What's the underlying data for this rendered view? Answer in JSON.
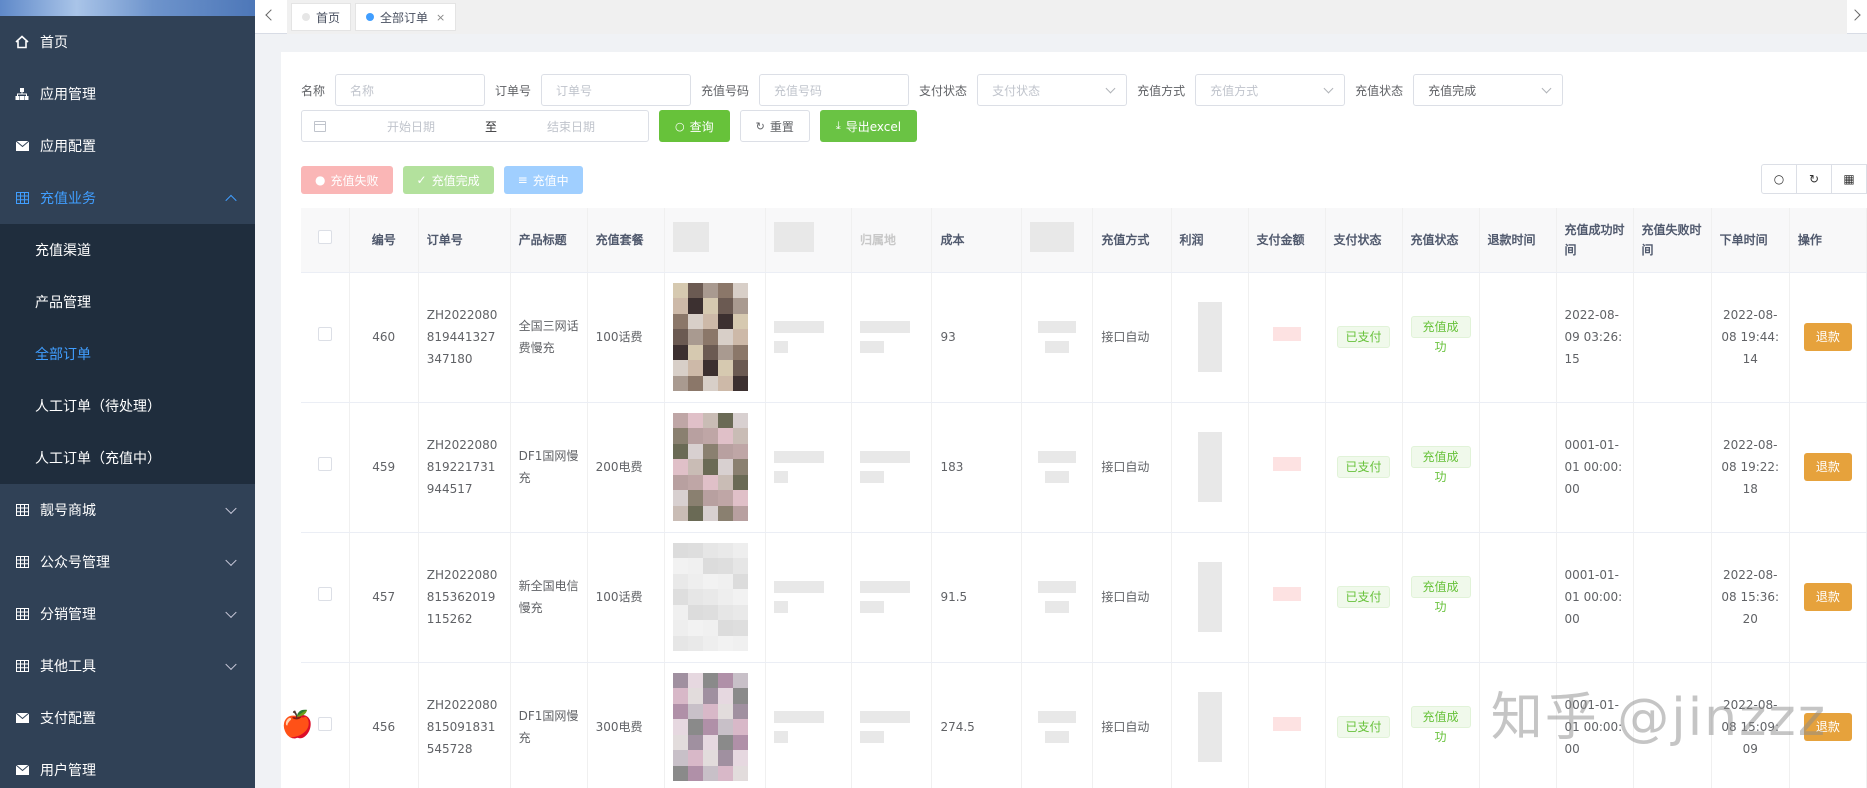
{
  "sidebar": {
    "items": [
      {
        "label": "首页",
        "icon": "home-icon"
      },
      {
        "label": "应用管理",
        "icon": "sitemap-icon"
      },
      {
        "label": "应用配置",
        "icon": "mail-icon"
      },
      {
        "label": "充值业务",
        "icon": "table-icon"
      },
      {
        "label": "靓号商城",
        "icon": "table-icon"
      },
      {
        "label": "公众号管理",
        "icon": "table-icon"
      },
      {
        "label": "分销管理",
        "icon": "table-icon"
      },
      {
        "label": "其他工具",
        "icon": "table-icon"
      },
      {
        "label": "支付配置",
        "icon": "mail-icon"
      },
      {
        "label": "用户管理",
        "icon": "mail-icon"
      }
    ],
    "sub_items": [
      "充值渠道",
      "产品管理",
      "全部订单",
      "人工订单（待处理）",
      "人工订单（充值中）"
    ]
  },
  "tabs": [
    {
      "label": "首页"
    },
    {
      "label": "全部订单",
      "close": "×"
    }
  ],
  "filters": {
    "name_label": "名称",
    "name_placeholder": "名称",
    "order_label": "订单号",
    "order_placeholder": "订单号",
    "phone_label": "充值号码",
    "phone_placeholder": "充值号码",
    "pay_status_label": "支付状态",
    "pay_status_placeholder": "支付状态",
    "method_label": "充值方式",
    "method_placeholder": "充值方式",
    "recharge_status_label": "充值状态",
    "recharge_status_value": "充值完成",
    "start_date": "开始日期",
    "sep": "至",
    "end_date": "结束日期"
  },
  "buttons": {
    "query": "查询",
    "reset": "重置",
    "export": "导出excel",
    "fail": "充值失败",
    "done": "充值完成",
    "doing": "充值中"
  },
  "table": {
    "headers": [
      "编号",
      "订单号",
      "产品标题",
      "充值套餐",
      "归属地",
      "成本",
      "充值方式",
      "利润",
      "支付金额",
      "支付状态",
      "充值状态",
      "退款时间",
      "充值成功时间",
      "充值失败时间",
      "下单时间",
      "操作"
    ],
    "rows": [
      {
        "id": "460",
        "order": "ZH2022080819441327347180",
        "title": "全国三网话费慢充",
        "pkg": "100话费",
        "cost": "93",
        "method": "接口自动",
        "pay": "已支付",
        "status": "充值成功",
        "success_time": "2022-08-09 03:26:15",
        "order_time": "2022-08-08 19:44:14",
        "action": "退款"
      },
      {
        "id": "459",
        "order": "ZH2022080819221731944517",
        "title": "DF1国网慢充",
        "pkg": "200电费",
        "cost": "183",
        "method": "接口自动",
        "pay": "已支付",
        "status": "充值成功",
        "success_time": "0001-01-01 00:00:00",
        "order_time": "2022-08-08 19:22:18",
        "action": "退款"
      },
      {
        "id": "457",
        "order": "ZH2022080815362019115262",
        "title": "新全国电信慢充",
        "pkg": "100话费",
        "cost": "91.5",
        "method": "接口自动",
        "pay": "已支付",
        "status": "充值成功",
        "success_time": "0001-01-01 00:00:00",
        "order_time": "2022-08-08 15:36:20",
        "action": "退款"
      },
      {
        "id": "456",
        "order": "ZH2022080815091831545728",
        "title": "DF1国网慢充",
        "pkg": "300电费",
        "cost": "274.5",
        "method": "接口自动",
        "pay": "已支付",
        "status": "充值成功",
        "success_time": "0001-01-01 00:00:00",
        "order_time": "2022-08-08 15:09:09",
        "action": "退款"
      }
    ]
  },
  "watermark": "知乎 @jinzzz",
  "colors": {
    "accent": "#409eff",
    "sidebar": "#304156",
    "success": "#67c23a",
    "warning": "#e6a23c"
  }
}
